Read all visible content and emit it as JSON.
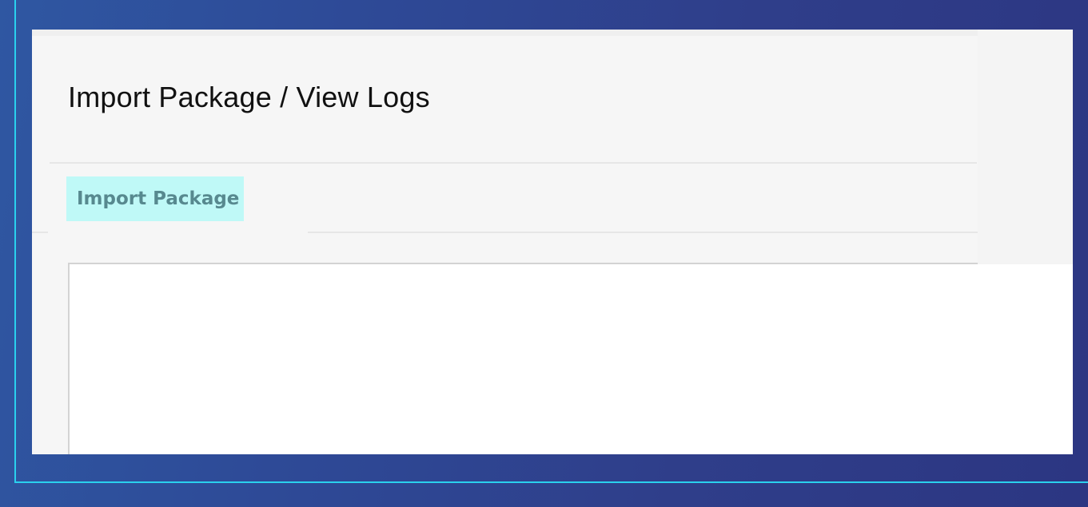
{
  "page": {
    "title": "Import Package / View Logs"
  },
  "tabs": [
    {
      "label": "Import Package",
      "active": true
    }
  ],
  "colors": {
    "background_gradient_start": "#2f57a2",
    "background_gradient_end": "#2c3682",
    "frame_border": "#2ad1ee",
    "window_background": "#f6f6f6",
    "active_tab_background": "#bff9f7",
    "active_tab_text": "#57898f",
    "content_background": "#ffffff"
  }
}
